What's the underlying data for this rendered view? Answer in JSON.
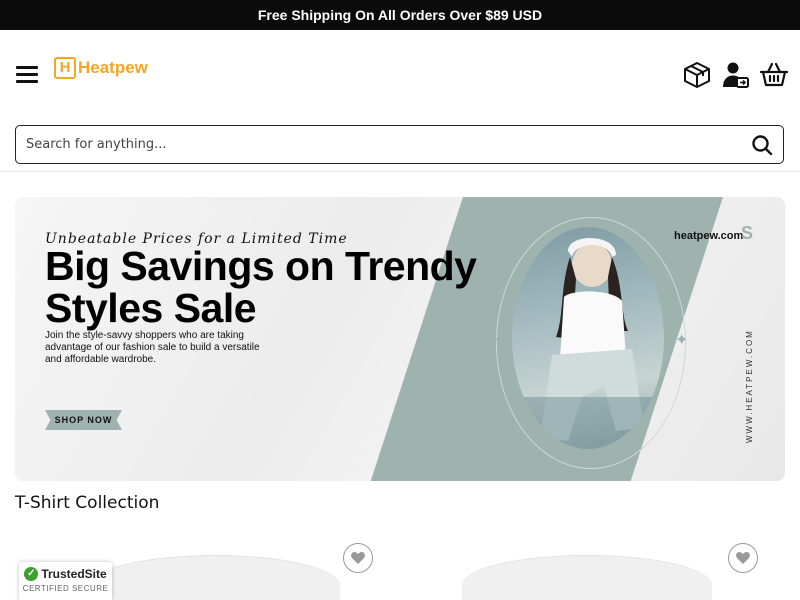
{
  "announcement": "Free Shipping On All Orders Over $89 USD",
  "header": {
    "logo_letter": "H",
    "logo_text": "Heatpew",
    "icons": [
      "box-icon",
      "user-account-icon",
      "cart-basket-icon"
    ]
  },
  "search": {
    "placeholder": "Search for anything..."
  },
  "banner": {
    "tagline": "Unbeatable Prices for a Limited Time",
    "headline": "Big Savings on Trendy Styles Sale",
    "subcopy": "Join the style-savvy shoppers who are taking advantage of our fashion sale to build a versatile and affordable wardrobe.",
    "cta": "SHOP NOW",
    "site": "heatpew.com",
    "site_mark": "S",
    "vertical_site": "WWW.HEATPEW.COM",
    "accent_color": "#9fb3ae"
  },
  "collection": {
    "title": "T-Shirt Collection"
  },
  "trust_badge": {
    "name": "TrustedSite",
    "sub": "CERTIFIED SECURE"
  },
  "colors": {
    "brand": "#f5a623",
    "topbar": "#0b0b0b"
  }
}
